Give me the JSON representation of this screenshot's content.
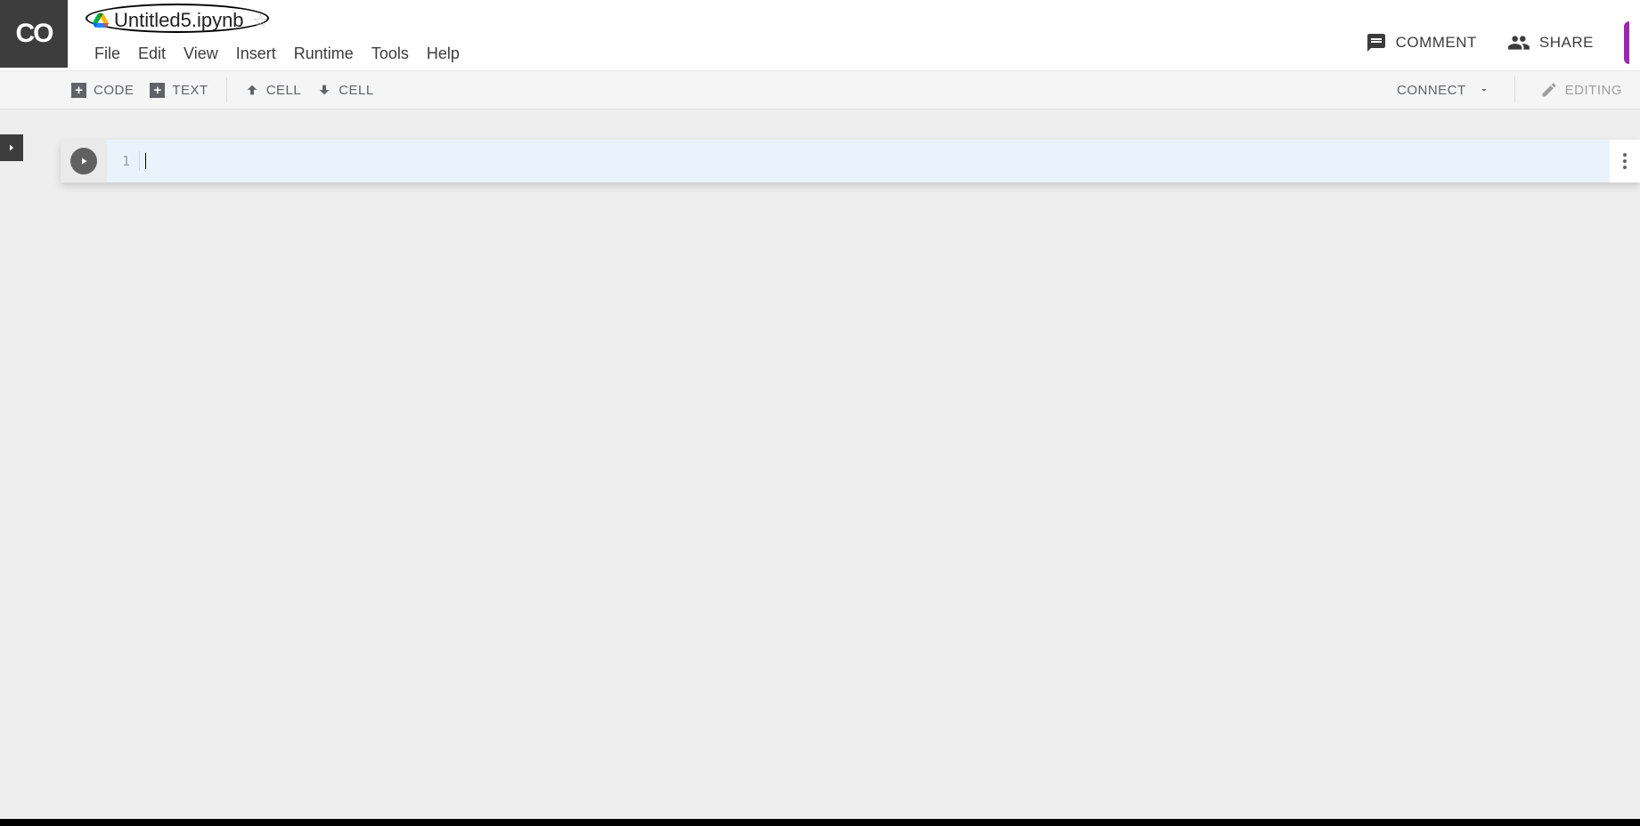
{
  "logo": "CO",
  "notebook_title": "Untitled5.ipynb",
  "menu": {
    "file": "File",
    "edit": "Edit",
    "view": "View",
    "insert": "Insert",
    "runtime": "Runtime",
    "tools": "Tools",
    "help": "Help"
  },
  "header_actions": {
    "comment": "COMMENT",
    "share": "SHARE"
  },
  "toolbar": {
    "code": "CODE",
    "text": "TEXT",
    "cell_up": "CELL",
    "cell_down": "CELL",
    "connect": "CONNECT",
    "editing": "EDITING"
  },
  "cell": {
    "line_number": "1",
    "content": ""
  }
}
